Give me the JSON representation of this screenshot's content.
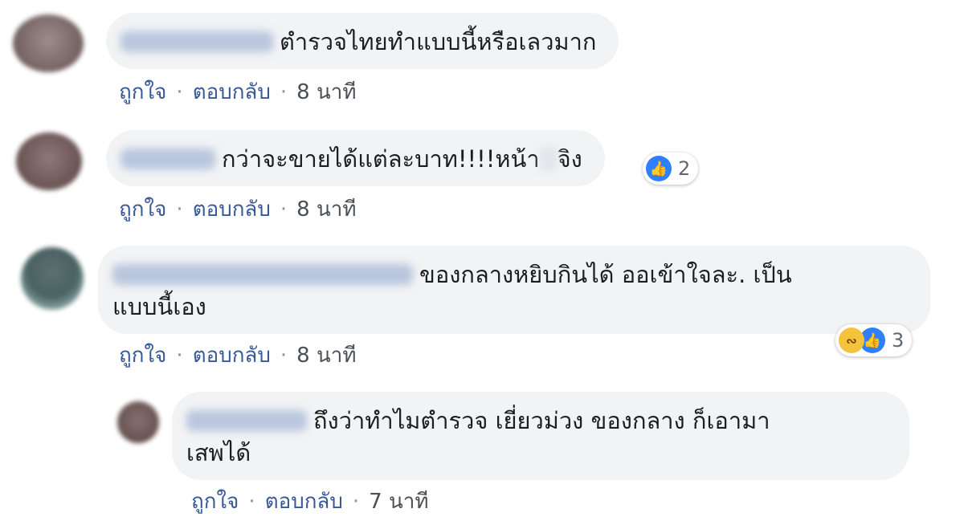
{
  "comments": [
    {
      "text": "ตำรวจไทยทำแบบนี้หรือเลวมาก",
      "like": "ถูกใจ",
      "reply": "ตอบกลับ",
      "time": "8 นาที"
    },
    {
      "text_a": "กว่าจะขายได้แต่ละบาท!!!!หน้า",
      "text_b": "จิง",
      "like": "ถูกใจ",
      "reply": "ตอบกลับ",
      "time": "8 นาที",
      "reaction_count": "2",
      "reaction_icon": "like-icon"
    },
    {
      "line1": "ของกลางหยิบกินได้ ออเข้าใจละ. เป็น",
      "line2": "แบบนี้เอง",
      "like": "ถูกใจ",
      "reply": "ตอบกลับ",
      "time": "8 นาที",
      "reaction_count": "3",
      "reaction_icons": [
        "haha-icon",
        "like-icon"
      ]
    },
    {
      "line1": "ถึงว่าทำไมตำรวจ เยี่ยวม่วง ของกลาง ก็เอามา",
      "line2": "เสพได้",
      "like": "ถูกใจ",
      "reply": "ตอบกลับ",
      "time": "7 นาที"
    }
  ],
  "separator": "·",
  "colors": {
    "bubble": "#f2f3f5",
    "link": "#385898",
    "like": "#2f80ff",
    "haha": "#f5c33b"
  }
}
